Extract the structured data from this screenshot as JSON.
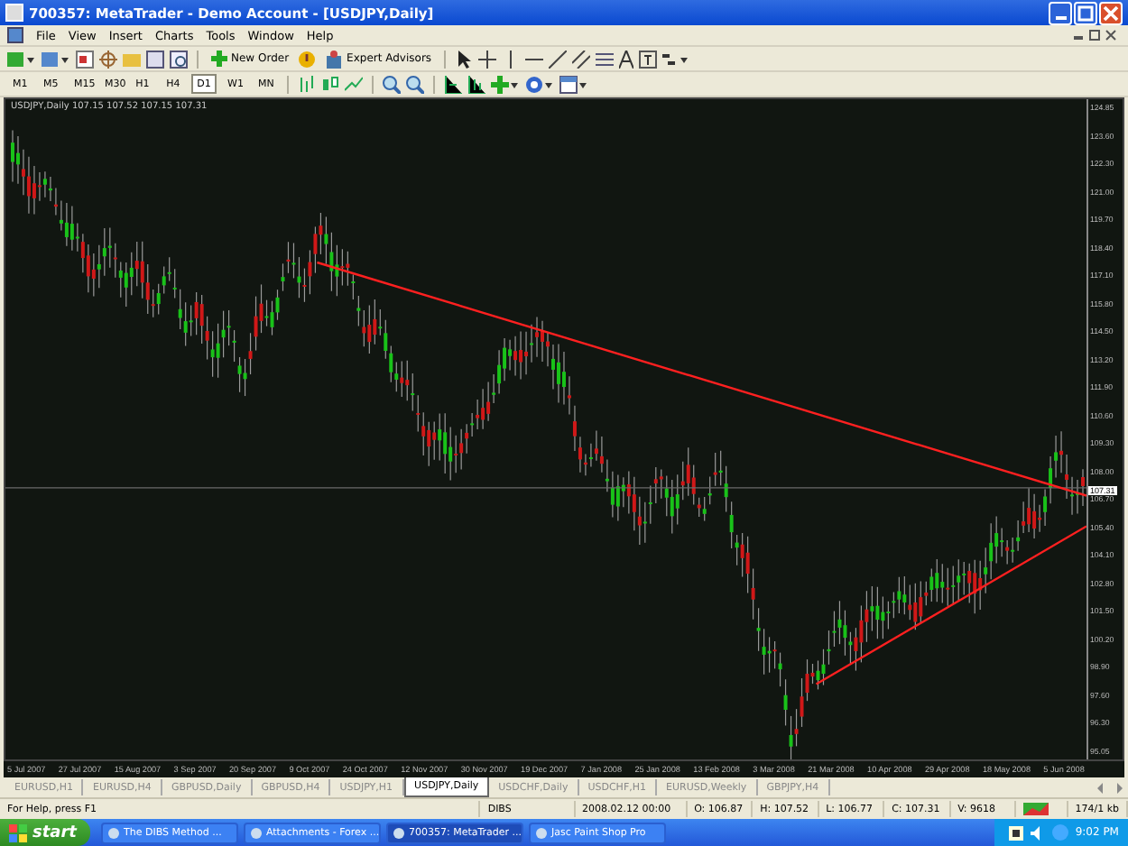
{
  "window": {
    "title": "700357: MetaTrader - Demo Account - [USDJPY,Daily]"
  },
  "menu": [
    "File",
    "View",
    "Insert",
    "Charts",
    "Tools",
    "Window",
    "Help"
  ],
  "toolbar": {
    "buttons": [
      "New Order",
      "Expert Advisors"
    ]
  },
  "timeframes": [
    {
      "label": "M1",
      "selected": false
    },
    {
      "label": "M5",
      "selected": false
    },
    {
      "label": "M15",
      "selected": false
    },
    {
      "label": "M30",
      "selected": false
    },
    {
      "label": "H1",
      "selected": false
    },
    {
      "label": "H4",
      "selected": false
    },
    {
      "label": "D1",
      "selected": true
    },
    {
      "label": "W1",
      "selected": false
    },
    {
      "label": "MN",
      "selected": false
    }
  ],
  "chart": {
    "header": "USDJPY,Daily  107.15 107.52 107.15 107.31",
    "current_price": "107.31",
    "price_axis": [
      "124.85",
      "123.60",
      "122.30",
      "121.00",
      "119.70",
      "118.40",
      "117.10",
      "115.80",
      "114.50",
      "113.20",
      "111.90",
      "110.60",
      "109.30",
      "108.00",
      "106.70",
      "105.40",
      "104.10",
      "102.80",
      "101.50",
      "100.20",
      "98.90",
      "97.60",
      "96.30",
      "95.05"
    ],
    "date_axis": [
      "5 Jul 2007",
      "27 Jul 2007",
      "15 Aug 2007",
      "3 Sep 2007",
      "20 Sep 2007",
      "9 Oct 2007",
      "24 Oct 2007",
      "12 Nov 2007",
      "30 Nov 2007",
      "19 Dec 2007",
      "7 Jan 2008",
      "25 Jan 2008",
      "13 Feb 2008",
      "3 Mar 2008",
      "21 Mar 2008",
      "10 Apr 2008",
      "29 Apr 2008",
      "18 May 2008",
      "5 Jun 2008"
    ]
  },
  "tabs": [
    {
      "label": "EURUSD,H1",
      "selected": false
    },
    {
      "label": "EURUSD,H4",
      "selected": false
    },
    {
      "label": "GBPUSD,Daily",
      "selected": false
    },
    {
      "label": "GBPUSD,H4",
      "selected": false
    },
    {
      "label": "USDJPY,H1",
      "selected": false
    },
    {
      "label": "USDJPY,Daily",
      "selected": true
    },
    {
      "label": "USDCHF,Daily",
      "selected": false
    },
    {
      "label": "USDCHF,H1",
      "selected": false
    },
    {
      "label": "EURUSD,Weekly",
      "selected": false
    },
    {
      "label": "GBPJPY,H4",
      "selected": false
    }
  ],
  "status_bar": {
    "help": "For Help, press F1",
    "profile": "DIBS",
    "time": "2008.02.12 00:00",
    "open": "O: 106.87",
    "high": "H: 107.52",
    "low": "L: 106.77",
    "close": "C: 107.31",
    "volume": "V: 9618",
    "traffic": "174/1 kb"
  },
  "taskbar": {
    "start": "start",
    "tasks": [
      {
        "label": "The DIBS Method ...",
        "selected": false
      },
      {
        "label": "Attachments - Forex ...",
        "selected": false
      },
      {
        "label": "700357: MetaTrader ...",
        "selected": true
      },
      {
        "label": "Jasc Paint Shop Pro",
        "selected": false
      }
    ],
    "clock": "9:02 PM"
  }
}
